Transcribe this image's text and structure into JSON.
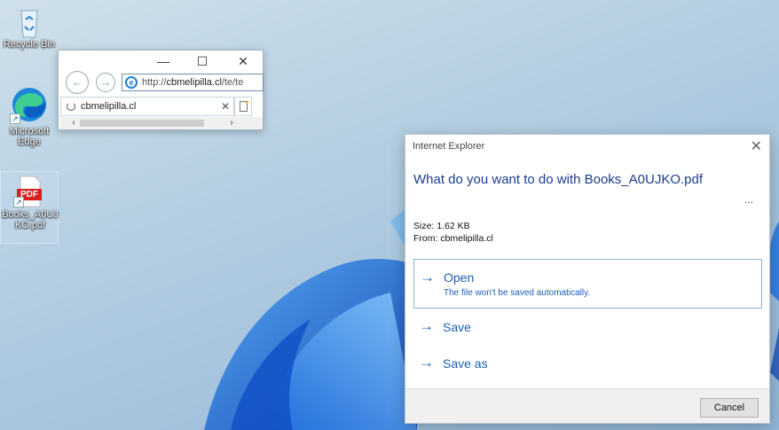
{
  "desktop": {
    "icons": [
      {
        "label": "Recycle Bin",
        "icon": "recycle-bin-icon"
      },
      {
        "label": "Microsoft Edge",
        "icon": "edge-icon"
      },
      {
        "label": "Books_A0UJKO.pdf",
        "icon": "pdf-icon",
        "badge": "PDF"
      }
    ]
  },
  "ie_window": {
    "controls": {
      "minimize": "—",
      "maximize": "☐",
      "close": "✕"
    },
    "address": {
      "prefix": "http://",
      "domain": "cbmelipilla.cl",
      "path": "/te/te"
    },
    "tab_title": "cbmelipilla.cl",
    "tab_close": "✕"
  },
  "dialog": {
    "title": "Internet Explorer",
    "close": "✕",
    "question": "What do you want to do with Books_A0UJKO.pdf",
    "more": "...",
    "size": "Size: 1.62 KB",
    "from": "From: cbmelipilla.cl",
    "options": [
      {
        "label": "Open",
        "sub": "The file won't be saved automatically."
      },
      {
        "label": "Save"
      },
      {
        "label": "Save as"
      }
    ],
    "cancel": "Cancel"
  },
  "colors": {
    "accent": "#1c5fb4",
    "dialog_heading": "#1c3d8c",
    "wallpaper_bloom": "#1565d8"
  }
}
